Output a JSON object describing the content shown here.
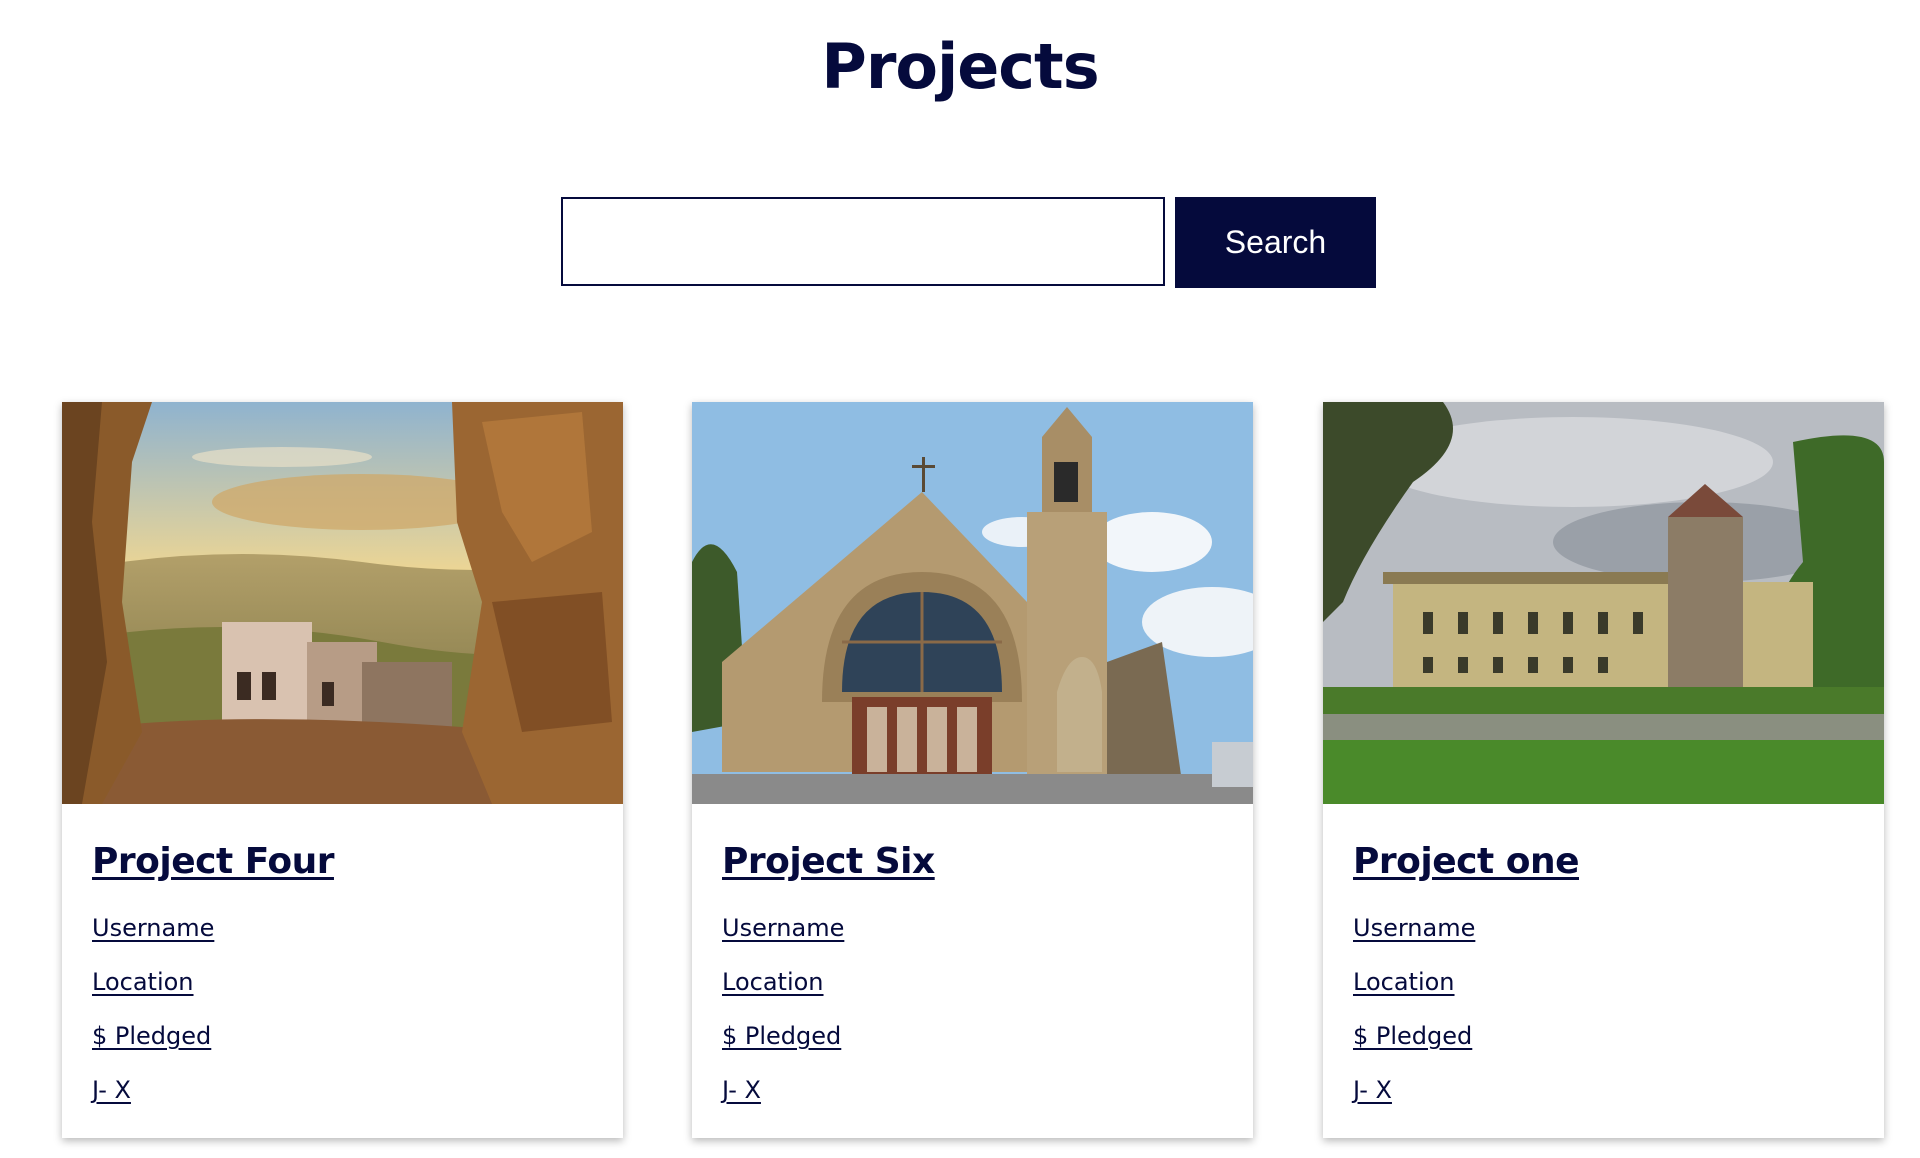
{
  "header": {
    "title": "Projects"
  },
  "search": {
    "placeholder": "",
    "value": "",
    "button_label": "Search"
  },
  "projects": [
    {
      "title": "Project Four",
      "username": "Username",
      "location": "Location",
      "pledged": "$ Pledged",
      "extra": "J- X"
    },
    {
      "title": "Project Six",
      "username": "Username",
      "location": "Location",
      "pledged": "$ Pledged",
      "extra": "J- X"
    },
    {
      "title": "Project one",
      "username": "Username",
      "location": "Location",
      "pledged": "$ Pledged",
      "extra": "J- X"
    }
  ],
  "colors": {
    "primary": "#050a3c",
    "background": "#ffffff"
  }
}
